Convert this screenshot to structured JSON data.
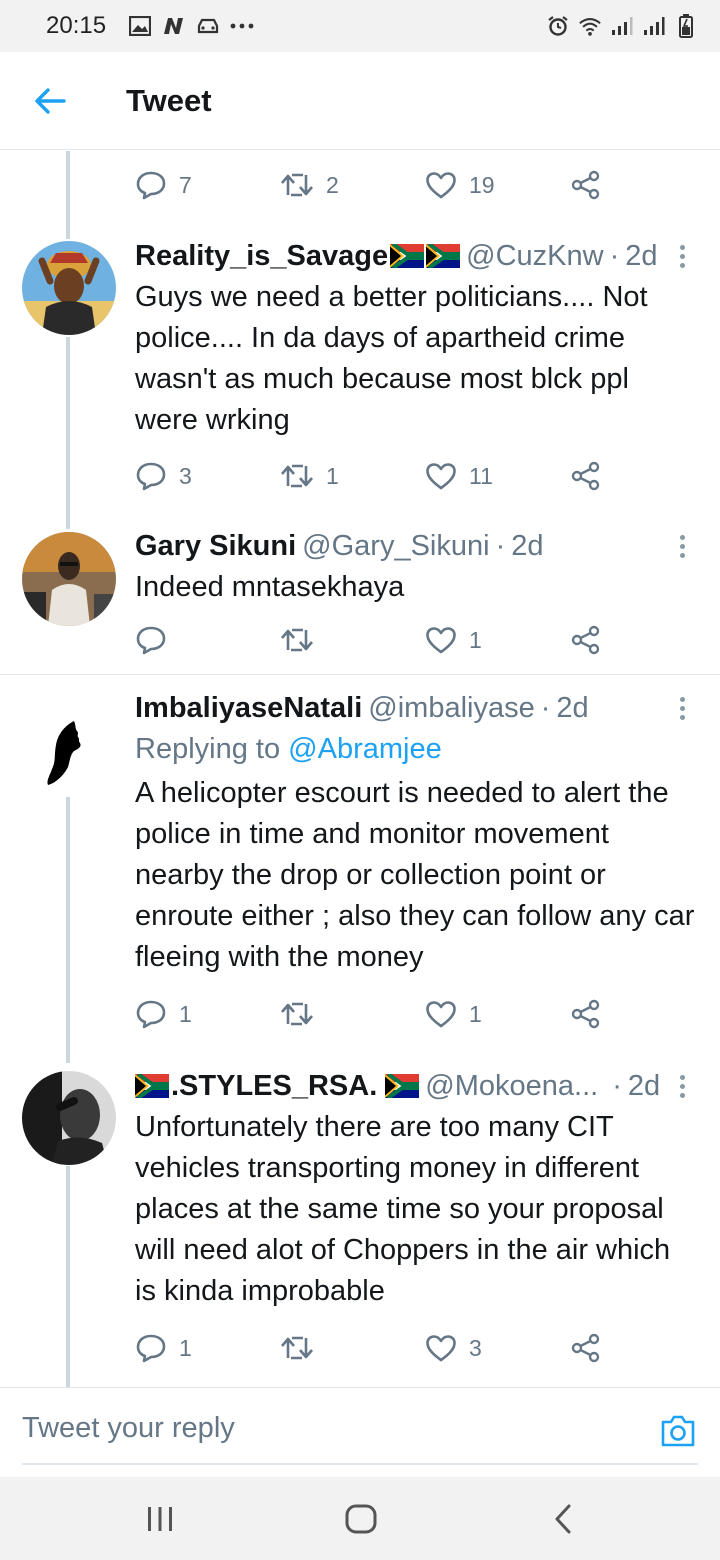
{
  "status_bar": {
    "time": "20:15",
    "left_icons": [
      "gallery-icon",
      "n-app-icon",
      "car-icon",
      "more-dots-icon"
    ],
    "right_icons": [
      "alarm-icon",
      "wifi-icon",
      "signal-icon",
      "signal-icon",
      "battery-icon"
    ]
  },
  "header": {
    "title": "Tweet",
    "back_icon": "arrow-left-icon",
    "accent": "#1da1f2"
  },
  "top_actions": {
    "replies": "7",
    "retweets": "2",
    "likes": "19"
  },
  "tweets": [
    {
      "name": "Reality_is_Savage",
      "handle": "@CuzKnw",
      "sep": "·",
      "time": "2d",
      "replying_to_label": "",
      "replying_to_handle": "",
      "text": "Guys we need a better politicians.... Not police.... In da days of apartheid crime wasn't as much because most blck ppl were wrking",
      "replies": "3",
      "retweets": "1",
      "likes": "11"
    },
    {
      "name": "Gary Sikuni",
      "handle": "@Gary_Sikuni",
      "sep": "·",
      "time": "2d",
      "text": "Indeed mntasekhaya",
      "replies": "",
      "retweets": "",
      "likes": "1"
    },
    {
      "name": "ImbaliyaseNatali",
      "handle": "@imbaliyase",
      "sep": "·",
      "time": "2d",
      "replying_to_label": "Replying to",
      "replying_to_handle": "@Abramjee",
      "text": "A helicopter escourt is needed to alert the police in time and monitor movement nearby the drop or collection point or enroute either ; also they can follow any car fleeing with the money",
      "replies": "1",
      "retweets": "",
      "likes": "1"
    },
    {
      "name": ".STYLES_RSA.",
      "handle": "@Mokoena...",
      "sep": "·",
      "time": "2d",
      "text": "Unfortunately there are too many CIT vehicles transporting money in different places at the same time so your proposal will need alot of Choppers in the air which is kinda improbable",
      "replies": "1",
      "retweets": "",
      "likes": "3"
    }
  ],
  "composer": {
    "placeholder": "Tweet your reply",
    "camera_icon": "camera-icon"
  },
  "navbar": {
    "icons": [
      "recent-apps-icon",
      "home-icon",
      "back-icon"
    ]
  },
  "colors": {
    "muted": "#657786",
    "text": "#14171a",
    "divider": "#e1e8ed",
    "thread": "#ccd6dd"
  }
}
